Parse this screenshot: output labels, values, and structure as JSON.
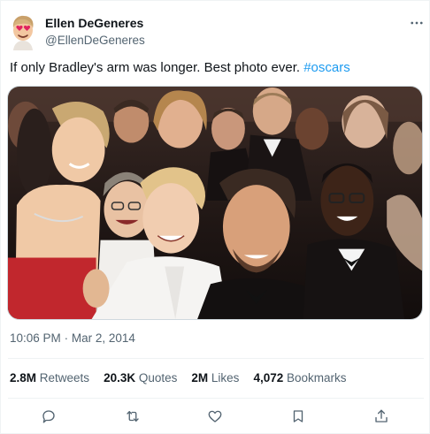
{
  "tweet": {
    "author_name": "Ellen DeGeneres",
    "author_handle": "@EllenDeGeneres",
    "text": "If only Bradley's arm was longer. Best photo ever.",
    "hashtag": "#oscars",
    "time": "10:06 PM",
    "separator": "·",
    "date": "Mar 2, 2014"
  },
  "stats": {
    "retweets_count": "2.8M",
    "retweets_label": "Retweets",
    "quotes_count": "20.3K",
    "quotes_label": "Quotes",
    "likes_count": "2M",
    "likes_label": "Likes",
    "bookmarks_count": "4,072",
    "bookmarks_label": "Bookmarks"
  },
  "icons": {
    "avatar": "heart-eyes-emoji",
    "more": "more-icon",
    "reply": "reply-icon",
    "retweet": "retweet-icon",
    "like": "like-icon",
    "bookmark": "bookmark-icon",
    "share": "share-icon"
  },
  "colors": {
    "link": "#1d9bf0",
    "text_primary": "#0f1419",
    "text_secondary": "#536471",
    "border": "#eff3f4"
  }
}
